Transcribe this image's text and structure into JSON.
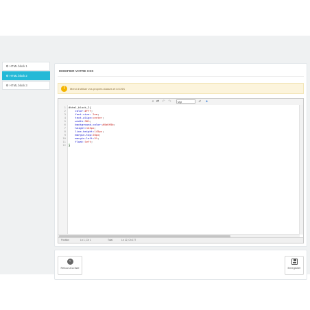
{
  "sidebar": {
    "items": [
      {
        "label": "HTML block 1",
        "icon": "cogs-icon",
        "active": false
      },
      {
        "label": "HTML block 2",
        "icon": "cogs-icon",
        "active": true
      },
      {
        "label": "HTML block 3",
        "icon": "cogs-icon",
        "active": false
      }
    ]
  },
  "panel": {
    "title": "MODIFIER VOTRE CSS",
    "alert": "Merci d'utiliser vos propres classes et id CSS"
  },
  "editor": {
    "font_select": "Mgt",
    "toolbar_icons": [
      "search-icon",
      "replace-icon",
      "undo-icon",
      "redo-icon",
      "font-size-select",
      "wrap-icon",
      "help-icon"
    ],
    "lines": [
      {
        "n": "1",
        "parts": [
          {
            "t": "#html_block_2{",
            "c": "sel"
          }
        ]
      },
      {
        "n": "2",
        "parts": [
          {
            "t": "    color:",
            "c": "prop"
          },
          {
            "t": "#fff",
            "c": "val"
          },
          {
            "t": ";",
            "c": "sel"
          }
        ]
      },
      {
        "n": "3",
        "parts": [
          {
            "t": "    font-size: ",
            "c": "prop"
          },
          {
            "t": "2em",
            "c": "val"
          },
          {
            "t": ";",
            "c": "sel"
          }
        ]
      },
      {
        "n": "4",
        "parts": [
          {
            "t": "    text-align:",
            "c": "prop"
          },
          {
            "t": "center",
            "c": "val"
          },
          {
            "t": ";",
            "c": "sel"
          }
        ]
      },
      {
        "n": "5",
        "parts": [
          {
            "t": "    width:",
            "c": "prop"
          },
          {
            "t": "30%",
            "c": "val"
          },
          {
            "t": ";",
            "c": "sel"
          }
        ]
      },
      {
        "n": "6",
        "parts": [
          {
            "t": "    background-color:",
            "c": "prop"
          },
          {
            "t": "#4b6f8b",
            "c": "val"
          },
          {
            "t": ";",
            "c": "sel"
          }
        ]
      },
      {
        "n": "7",
        "parts": [
          {
            "t": "    height:",
            "c": "prop"
          },
          {
            "t": "145px",
            "c": "val"
          },
          {
            "t": ";",
            "c": "sel"
          }
        ]
      },
      {
        "n": "8",
        "parts": [
          {
            "t": "    line-height:",
            "c": "prop"
          },
          {
            "t": "145px",
            "c": "val"
          },
          {
            "t": ";",
            "c": "sel"
          }
        ]
      },
      {
        "n": "9",
        "parts": [
          {
            "t": "    margin-top:",
            "c": "prop"
          },
          {
            "t": "20px",
            "c": "val"
          },
          {
            "t": ";",
            "c": "sel"
          }
        ]
      },
      {
        "n": "10",
        "parts": [
          {
            "t": "    margin-left:",
            "c": "prop"
          },
          {
            "t": "5%",
            "c": "val"
          },
          {
            "t": ";",
            "c": "sel"
          }
        ]
      },
      {
        "n": "11",
        "parts": [
          {
            "t": "    float:",
            "c": "prop"
          },
          {
            "t": "left",
            "c": "val"
          },
          {
            "t": ";",
            "c": "sel"
          }
        ]
      },
      {
        "n": "12",
        "parts": [
          {
            "t": "}",
            "c": "brace"
          }
        ]
      }
    ],
    "status": {
      "position_label": "Position",
      "position_value": "Ln 1, Ch 1",
      "total_label": "Total",
      "total_value": "Ln 12, Ch 177"
    }
  },
  "footer": {
    "back_label": "Retour à la liste",
    "save_label": "Enregistrer"
  }
}
